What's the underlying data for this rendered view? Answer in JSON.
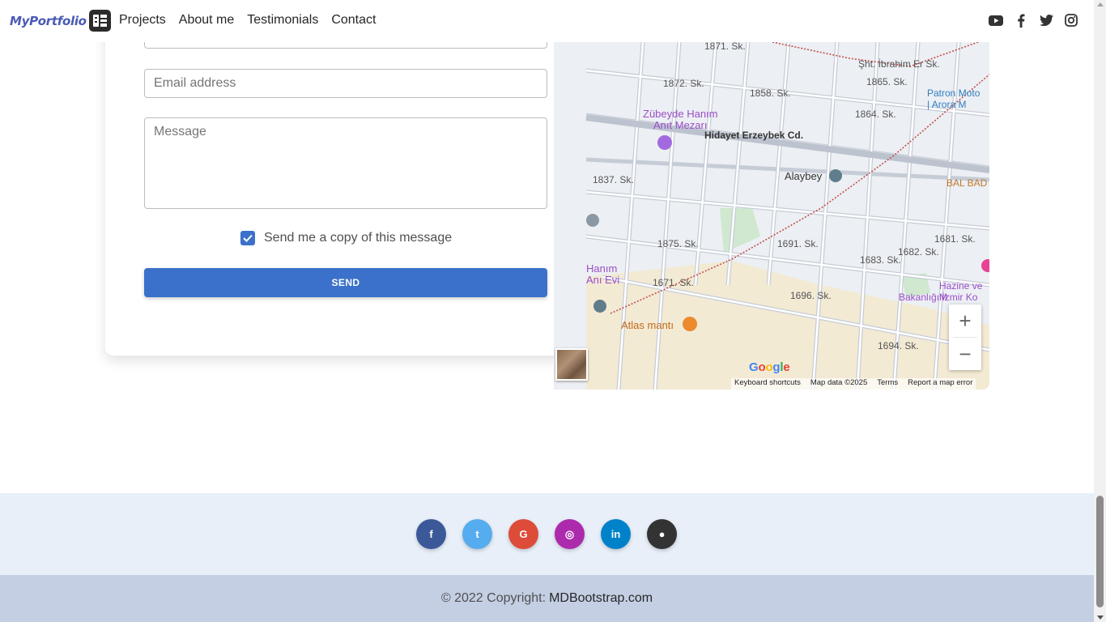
{
  "navbar": {
    "brand_text": "MyPortfolio",
    "links": [
      "Projects",
      "About me",
      "Testimonials",
      "Contact"
    ],
    "social_icons": [
      "youtube-icon",
      "facebook-icon",
      "twitter-icon",
      "instagram-icon"
    ]
  },
  "form": {
    "email_placeholder": "Email address",
    "message_placeholder": "Message",
    "copy_checkbox_label": "Send me a copy of this message",
    "copy_checked": true,
    "send_label": "SEND",
    "accent_color": "#3b71ca"
  },
  "map": {
    "labels": {
      "street_1871": "1871. Sk.",
      "street_1872": "1872. Sk.",
      "street_1858": "1858. Sk.",
      "ibrahim": "Şht. İbrahim Er Sk.",
      "street_1865": "1865. Sk.",
      "street_1864": "1864. Sk.",
      "patron_1": "Patron Moto",
      "patron_2": "| Arora M",
      "zubeyde_1": "Zübeyde Hanım",
      "zubeyde_2": "Anıt Mezarı",
      "hidayet": "Hidayet Erzeybek Cd.",
      "street_1837": "1837. Sk.",
      "alaybey": "Alaybey",
      "bal_bad": "BAL BAD",
      "street_1875": "1875. Sk.",
      "street_1691": "1691. Sk.",
      "street_1683": "1683. Sk.",
      "street_1682": "1682. Sk.",
      "street_1681": "1681. Sk.",
      "hanim_1": "Hanım",
      "hanim_2": "Anı Evi",
      "street_1671": "1671. Sk.",
      "street_1696": "1696. Sk.",
      "hazine_1": "Hazine ve M",
      "hazine_2": "Bakanlığı İzmir Ko",
      "atlas": "Atlas mantı",
      "street_1694": "1694. Sk."
    },
    "google_logo": "Google",
    "attribution": [
      "Keyboard shortcuts",
      "Map data ©2025",
      "Terms",
      "Report a map error"
    ],
    "zoom_in": "+",
    "zoom_out": "−"
  },
  "footer": {
    "social_buttons": [
      {
        "icon": "facebook-icon",
        "glyph": "f",
        "color": "#3b5998"
      },
      {
        "icon": "twitter-icon",
        "glyph": "t",
        "color": "#55acee"
      },
      {
        "icon": "google-icon",
        "glyph": "G",
        "color": "#dd4b39"
      },
      {
        "icon": "instagram-icon",
        "glyph": "◎",
        "color": "#ac2bac"
      },
      {
        "icon": "linkedin-icon",
        "glyph": "in",
        "color": "#0082ca"
      },
      {
        "icon": "github-icon",
        "glyph": "●",
        "color": "#333333"
      }
    ],
    "copyright_text": "© 2022 Copyright:",
    "copyright_link": "MDBootstrap.com"
  }
}
